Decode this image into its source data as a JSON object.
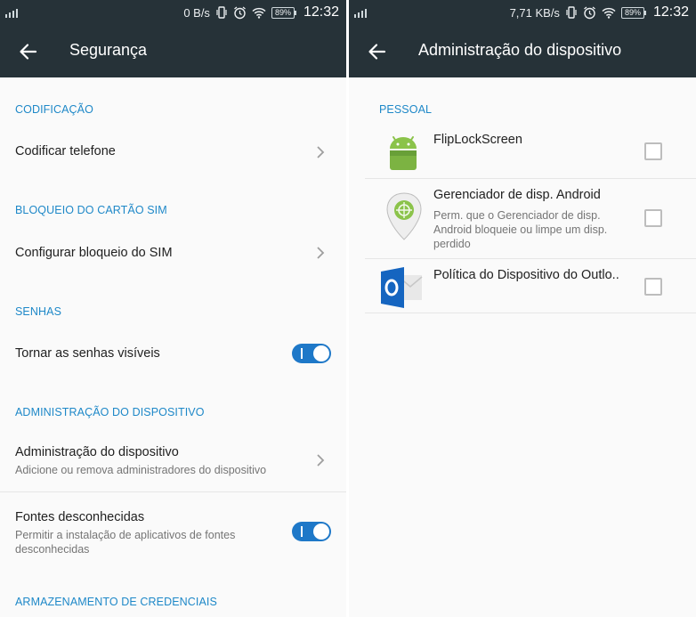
{
  "left": {
    "status": {
      "speed": "0 B/s",
      "battery": "89%",
      "time": "12:32"
    },
    "title": "Segurança",
    "sections": {
      "codificacao": "CODIFICAÇÃO",
      "sim": "BLOQUEIO DO CARTÃO SIM",
      "senhas": "SENHAS",
      "admin": "ADMINISTRAÇÃO DO DISPOSITIVO",
      "credenciais": "ARMAZENAMENTO DE CREDENCIAIS"
    },
    "items": {
      "codificar": {
        "title": "Codificar telefone"
      },
      "sim": {
        "title": "Configurar bloqueio do SIM"
      },
      "senhas": {
        "title": "Tornar as senhas visíveis",
        "enabled": true
      },
      "admin": {
        "title": "Administração do dispositivo",
        "subtitle": "Adicione ou remova administradores do dispositivo"
      },
      "fontes": {
        "title": "Fontes desconhecidas",
        "subtitle": "Permitir a instalação de aplicativos de fontes desconhecidas",
        "enabled": true
      }
    }
  },
  "right": {
    "status": {
      "speed": "7,71 KB/s",
      "battery": "89%",
      "time": "12:32"
    },
    "title": "Administração do dispositivo",
    "section": "PESSOAL",
    "apps": [
      {
        "name": "FlipLockScreen",
        "icon": "android-robot-icon",
        "checked": false
      },
      {
        "name": "Gerenciador de disp. Android",
        "description": "Perm. que o Gerenciador de disp. Android bloqueie ou limpe um disp. perdido",
        "icon": "device-manager-icon",
        "checked": false
      },
      {
        "name": "Política do Dispositivo do Outlo..",
        "icon": "outlook-icon",
        "checked": false
      }
    ]
  },
  "colors": {
    "appbar": "#263238",
    "accent": "#1e88c8",
    "toggle": "#1e78c8"
  }
}
